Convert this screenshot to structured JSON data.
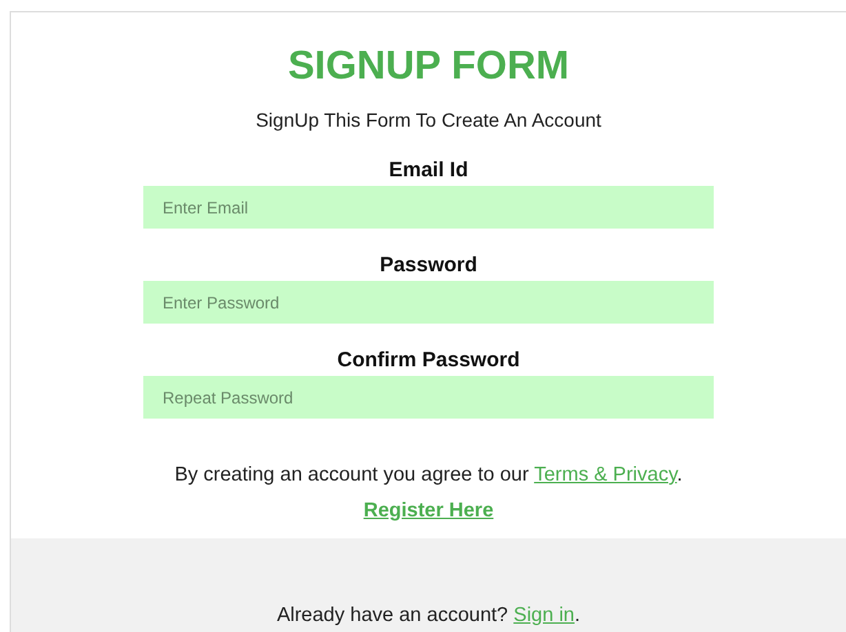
{
  "title": "SIGNUP FORM",
  "subtitle": "SignUp This Form To Create An Account",
  "fields": [
    {
      "label": "Email Id",
      "placeholder": "Enter Email"
    },
    {
      "label": "Password",
      "placeholder": "Enter Password"
    },
    {
      "label": "Confirm Password",
      "placeholder": "Repeat Password"
    }
  ],
  "terms": {
    "text": "By creating an account you agree to our",
    "link": "Terms & Privacy",
    "end": "."
  },
  "register": "Register Here",
  "footer": {
    "text": "Already have an account?",
    "link": "Sign in",
    "end": "."
  }
}
